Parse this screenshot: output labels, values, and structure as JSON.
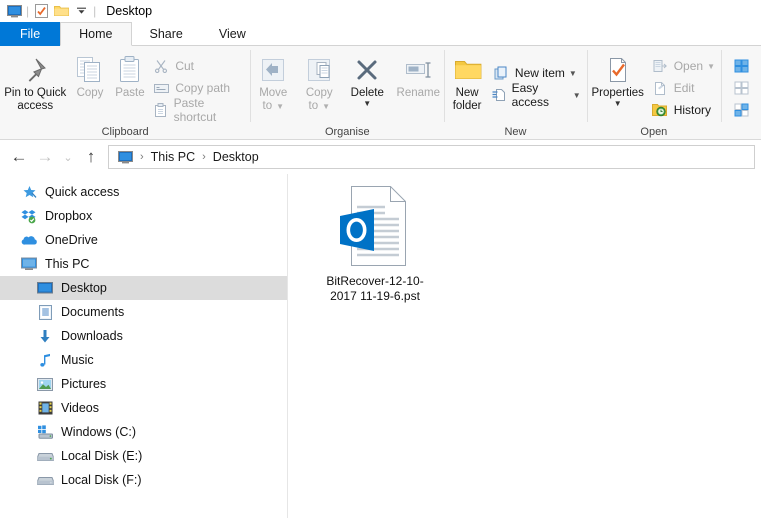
{
  "window": {
    "title": "Desktop"
  },
  "quick_access_toolbar": {
    "items": [
      {
        "name": "properties-qat",
        "icon": "monitor-icon"
      },
      {
        "name": "properties-check-qat",
        "icon": "properties-check-icon"
      },
      {
        "name": "new-folder-qat",
        "icon": "folder-icon"
      },
      {
        "name": "customize-qat",
        "icon": "chevron-down-icon"
      }
    ]
  },
  "tabs": [
    {
      "label": "File",
      "id": "file"
    },
    {
      "label": "Home",
      "id": "home"
    },
    {
      "label": "Share",
      "id": "share"
    },
    {
      "label": "View",
      "id": "view"
    }
  ],
  "ribbon": {
    "groups": [
      {
        "label": "Clipboard",
        "big_buttons": [
          {
            "label_line1": "Pin to Quick",
            "label_line2": "access",
            "icon": "pin-icon",
            "disabled": false
          },
          {
            "label_line1": "Copy",
            "label_line2": "",
            "icon": "copy-icon",
            "disabled": true
          },
          {
            "label_line1": "Paste",
            "label_line2": "",
            "icon": "paste-icon",
            "disabled": true
          }
        ],
        "small_buttons": [
          {
            "label": "Cut",
            "icon": "scissors-icon",
            "disabled": true
          },
          {
            "label": "Copy path",
            "icon": "copy-path-icon",
            "disabled": true
          },
          {
            "label": "Paste shortcut",
            "icon": "paste-shortcut-icon",
            "disabled": true
          }
        ]
      },
      {
        "label": "Organise",
        "big_buttons": [
          {
            "label_line1": "Move",
            "label_line2": "to",
            "icon": "move-to-icon",
            "disabled": true,
            "caret": true
          },
          {
            "label_line1": "Copy",
            "label_line2": "to",
            "icon": "copy-to-icon",
            "disabled": true,
            "caret": true
          },
          {
            "label_line1": "Delete",
            "label_line2": "",
            "icon": "delete-x-icon",
            "disabled": false,
            "split": true
          },
          {
            "label_line1": "Rename",
            "label_line2": "",
            "icon": "rename-icon",
            "disabled": true
          }
        ],
        "small_buttons": []
      },
      {
        "label": "New",
        "big_buttons": [
          {
            "label_line1": "New",
            "label_line2": "folder",
            "icon": "new-folder-icon",
            "disabled": false
          }
        ],
        "small_buttons": [
          {
            "label": "New item",
            "icon": "new-item-icon",
            "disabled": false,
            "caret": true
          },
          {
            "label": "Easy access",
            "icon": "easy-access-icon",
            "disabled": false,
            "caret": true
          }
        ]
      },
      {
        "label": "Open",
        "big_buttons": [
          {
            "label_line1": "Properties",
            "label_line2": "",
            "icon": "properties-icon",
            "disabled": false,
            "split": true
          }
        ],
        "small_buttons": [
          {
            "label": "Open",
            "icon": "open-icon",
            "disabled": true,
            "caret": true
          },
          {
            "label": "Edit",
            "icon": "edit-icon",
            "disabled": true
          },
          {
            "label": "History",
            "icon": "history-icon",
            "disabled": false
          }
        ]
      },
      {
        "label": "",
        "big_buttons": [],
        "small_buttons": [
          {
            "label": "",
            "icon": "select-all-icon",
            "disabled": false
          },
          {
            "label": "",
            "icon": "select-none-icon",
            "disabled": false
          },
          {
            "label": "",
            "icon": "invert-selection-icon",
            "disabled": false
          }
        ]
      }
    ]
  },
  "addressbar": {
    "back": "←",
    "forward": "→",
    "recent": "⌄",
    "up": "↑",
    "crumbs": [
      "This PC",
      "Desktop"
    ],
    "separator": "›"
  },
  "sidebar": {
    "items": [
      {
        "label": "Quick access",
        "icon": "star-pin-icon",
        "indent": false,
        "selected": false
      },
      {
        "label": "Dropbox",
        "icon": "dropbox-icon",
        "indent": false,
        "selected": false
      },
      {
        "label": "OneDrive",
        "icon": "onedrive-cloud-icon",
        "indent": false,
        "selected": false
      },
      {
        "label": "This PC",
        "icon": "monitor-icon",
        "indent": false,
        "selected": false
      },
      {
        "label": "Desktop",
        "icon": "desktop-icon",
        "indent": true,
        "selected": true
      },
      {
        "label": "Documents",
        "icon": "documents-icon",
        "indent": true,
        "selected": false
      },
      {
        "label": "Downloads",
        "icon": "downloads-arrow-icon",
        "indent": true,
        "selected": false
      },
      {
        "label": "Music",
        "icon": "music-note-icon",
        "indent": true,
        "selected": false
      },
      {
        "label": "Pictures",
        "icon": "pictures-icon",
        "indent": true,
        "selected": false
      },
      {
        "label": "Videos",
        "icon": "videos-icon",
        "indent": true,
        "selected": false
      },
      {
        "label": "Windows (C:)",
        "icon": "windows-drive-icon",
        "indent": true,
        "selected": false
      },
      {
        "label": "Local Disk (E:)",
        "icon": "drive-icon",
        "indent": true,
        "selected": false
      },
      {
        "label": "Local Disk (F:)",
        "icon": "drive-icon",
        "indent": true,
        "selected": false
      }
    ]
  },
  "content": {
    "files": [
      {
        "name": "BitRecover-12-10-2017 11-19-6.pst",
        "icon": "outlook-pst-icon"
      }
    ]
  },
  "colors": {
    "accent_blue": "#0078d7",
    "ribbon_bg": "#f7f7f7",
    "selection_gray": "#dcdcdc",
    "outlook_blue": "#0072c6",
    "folder_yellow": "#ffd862",
    "orange_check": "#e8692b"
  }
}
